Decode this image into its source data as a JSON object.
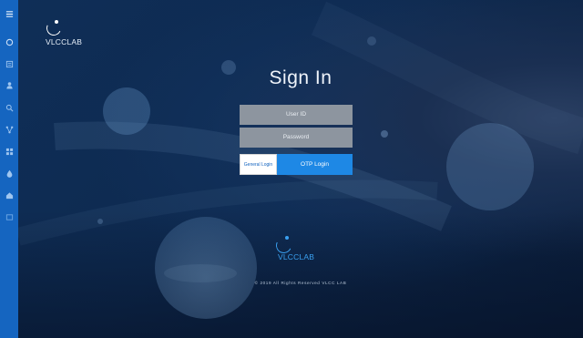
{
  "sidebar": {
    "items": [
      {
        "icon": "menu-icon"
      },
      {
        "icon": "circle-icon"
      },
      {
        "icon": "list-icon"
      },
      {
        "icon": "user-icon"
      },
      {
        "icon": "search-icon"
      },
      {
        "icon": "network-icon"
      },
      {
        "icon": "grid-icon"
      },
      {
        "icon": "drop-icon"
      },
      {
        "icon": "home-icon"
      },
      {
        "icon": "box-icon"
      }
    ]
  },
  "brand": {
    "logo_text": "VLCCLAB"
  },
  "login": {
    "title": "Sign In",
    "user_id_placeholder": "User ID",
    "password_placeholder": "Password",
    "general_login_label": "General Login",
    "otp_login_label": "OTP Login"
  },
  "footer": {
    "logo_text": "VLCCLAB",
    "copyright": "© 2019 All Rights Reserved VLCC LAB"
  },
  "colors": {
    "sidebar": "#1565c0",
    "background": "#0e2a50",
    "accent": "#1e88e5",
    "field": "#8d959f"
  }
}
